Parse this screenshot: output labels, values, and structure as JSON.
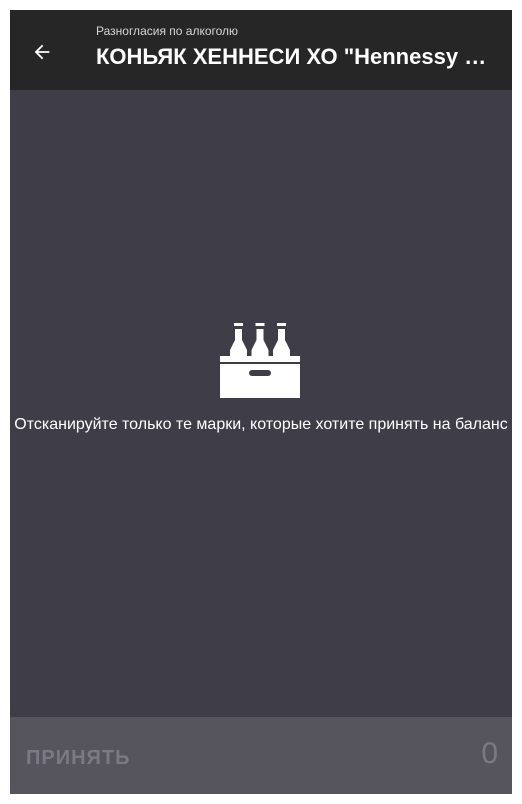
{
  "header": {
    "subtitle": "Разногласия по алкоголю",
    "title": "КОНЬЯК ХЕННЕСИ ХО \"Hennessy XO\""
  },
  "main": {
    "icon": "bottle-crate-icon",
    "message": "Отсканируйте только те марки, которые хотите принять на баланс"
  },
  "footer": {
    "accept_label": "ПРИНЯТЬ",
    "count": "0"
  },
  "colors": {
    "app_bar": "#262626",
    "background": "#3f3e48",
    "bottom_bar": "#56555e",
    "disabled_text": "#7b7a82"
  }
}
